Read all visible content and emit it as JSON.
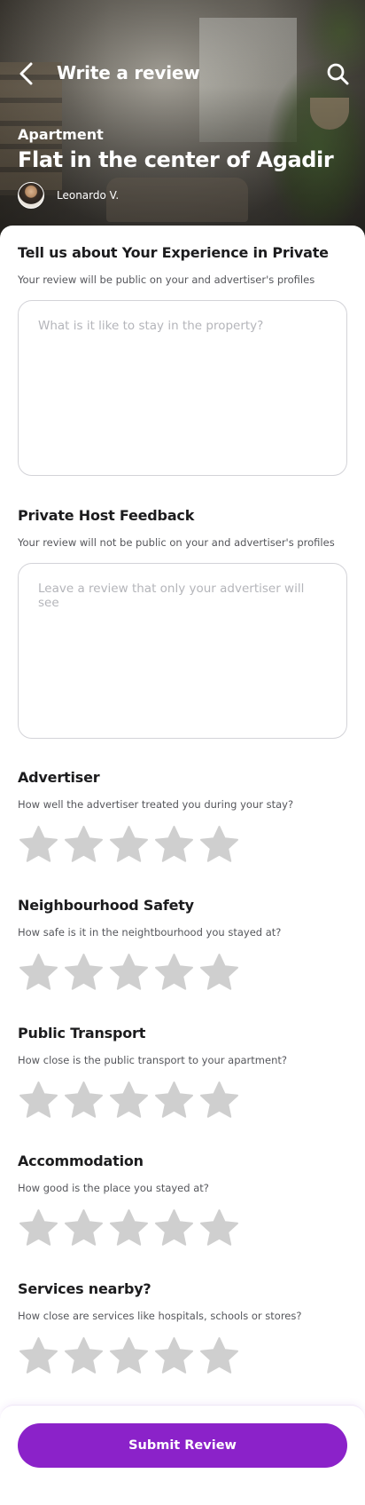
{
  "header": {
    "title": "Write a review",
    "back_icon": "chevron-left-icon",
    "search_icon": "search-icon"
  },
  "property": {
    "type": "Apartment",
    "title": "Flat in the center of Agadir",
    "host_name": "Leonardo V."
  },
  "public_review": {
    "title": "Tell us about Your Experience in Private",
    "subtitle": "Your review will be public on your and advertiser's profiles",
    "placeholder": "What is it like to stay in the property?",
    "value": ""
  },
  "private_feedback": {
    "title": "Private Host Feedback",
    "subtitle": "Your review will not be public on your and advertiser's profiles",
    "placeholder": "Leave a review that only your advertiser will see",
    "value": ""
  },
  "ratings": [
    {
      "title": "Advertiser",
      "question": "How well the advertiser treated you during your stay?",
      "rating": 0,
      "max": 5
    },
    {
      "title": "Neighbourhood Safety",
      "question": "How safe is it in the neightbourhood you stayed at?",
      "rating": 0,
      "max": 5
    },
    {
      "title": "Public Transport",
      "question": "How close is the public transport to your apartment?",
      "rating": 0,
      "max": 5
    },
    {
      "title": "Accommodation",
      "question": "How good is the place you stayed at?",
      "rating": 0,
      "max": 5
    },
    {
      "title": "Services nearby?",
      "question": "How close are services like hospitals, schools or stores?",
      "rating": 0,
      "max": 5
    }
  ],
  "submit": {
    "label": "Submit Review"
  },
  "colors": {
    "accent": "#8b22c9",
    "star_empty": "#cfcfcf",
    "text_primary": "#1c1c1e",
    "text_secondary": "#55565b",
    "border": "#d3d3d8"
  }
}
